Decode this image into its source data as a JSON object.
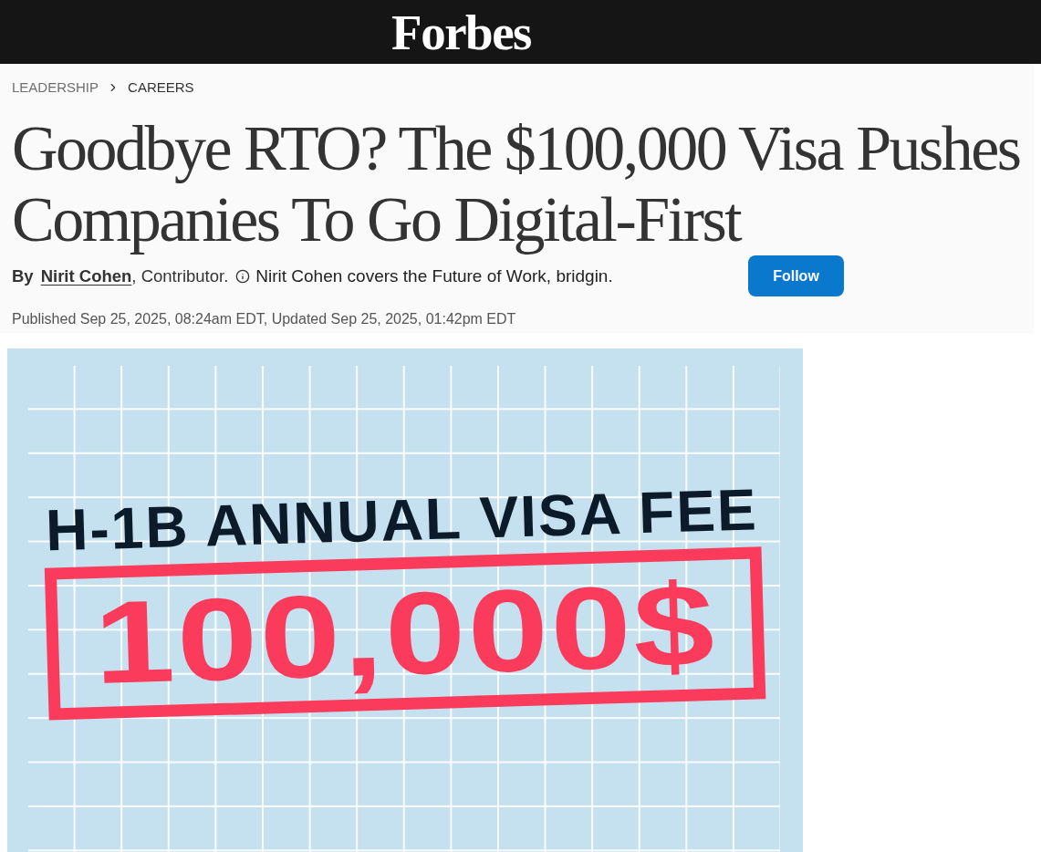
{
  "header": {
    "logo": "Forbes"
  },
  "breadcrumb": [
    {
      "label": "LEADERSHIP"
    },
    {
      "label": "CAREERS"
    }
  ],
  "headline": "Goodbye RTO? The $100,000 Visa Pushes Companies To Go Digital-First",
  "byline": {
    "prefix": "By",
    "author": "Nirit Cohen",
    "suffix": ", Contributor.",
    "bio": "Nirit Cohen covers the Future of Work, bridgin."
  },
  "follow_button": "Follow",
  "published": "Published Sep 25, 2025, 08:24am EDT, Updated Sep 25, 2025, 01:42pm EDT",
  "hero_image": {
    "title": "H-1B ANNUAL VISA FEE",
    "amount": "100,000$"
  }
}
